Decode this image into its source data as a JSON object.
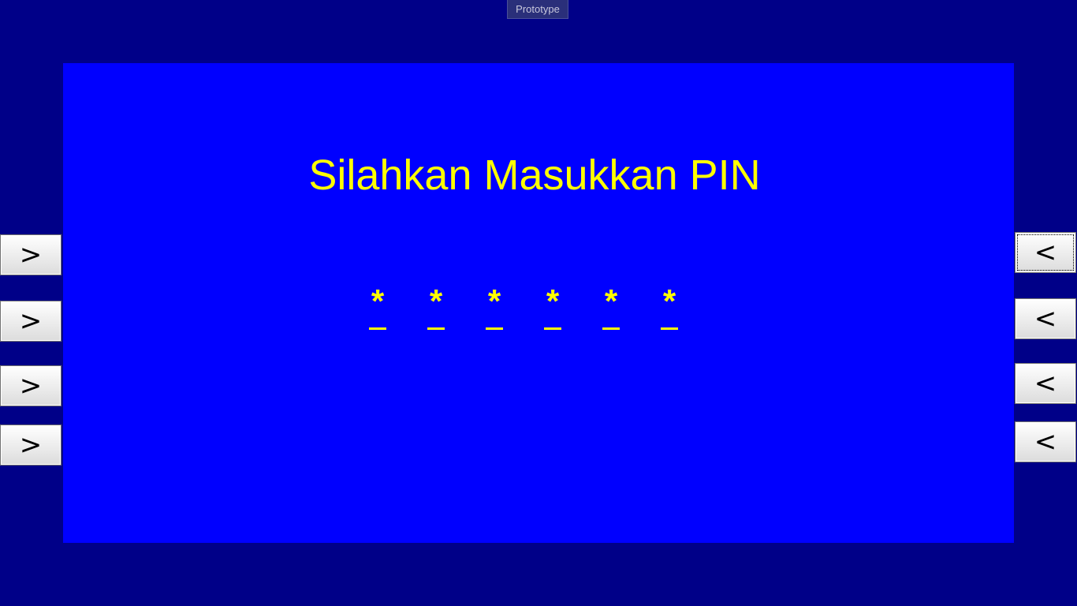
{
  "header": {
    "prototype_label": "Prototype"
  },
  "screen": {
    "title": "Silahkan Masukkan PIN",
    "pin_chars": [
      "*",
      "*",
      "*",
      "*",
      "*",
      "*"
    ],
    "bg_color": "#0000ff",
    "text_color": "#ffff00"
  },
  "left_buttons": [
    ">",
    ">",
    ">",
    ">"
  ],
  "right_buttons": [
    "<",
    "<",
    "<",
    "<"
  ],
  "colors": {
    "outer_background": "#000088",
    "screen_background": "#0000ff",
    "text": "#ffff00"
  }
}
